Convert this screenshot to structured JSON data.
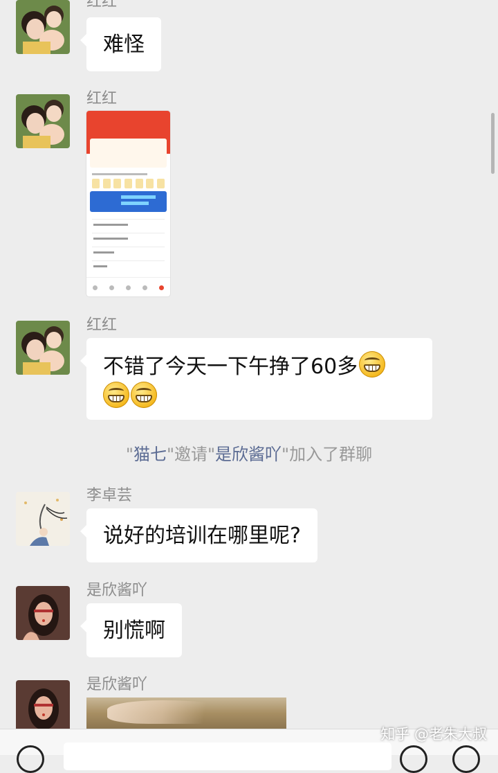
{
  "chat": {
    "messages": [
      {
        "sender": "红红",
        "text": "难怪",
        "avatar": "avatar-hong"
      },
      {
        "sender": "红红",
        "type": "image",
        "avatar": "avatar-hong"
      },
      {
        "sender": "红红",
        "text": "不错了今天一下午挣了60多",
        "emoji_count_inline": 1,
        "emoji_count_line2": 2,
        "avatar": "avatar-hong"
      },
      {
        "sender": "李卓芸",
        "text": "说好的培训在哪里呢?",
        "avatar": "avatar-li"
      },
      {
        "sender": "是欣酱吖",
        "text": "别慌啊",
        "avatar": "avatar-xin"
      },
      {
        "sender": "是欣酱吖",
        "type": "image",
        "avatar": "avatar-xin"
      }
    ],
    "system_note": {
      "q1": "\"",
      "inviter": "猫七",
      "mid": "\"邀请\"",
      "invitee": "是欣酱吖",
      "tail": "\"加入了群聊"
    }
  },
  "watermark": "知乎 @老朱大叔",
  "colors": {
    "background": "#ededed",
    "bubble": "#ffffff",
    "name_link": "#5b6b93",
    "emoji": "#f5b91f"
  }
}
